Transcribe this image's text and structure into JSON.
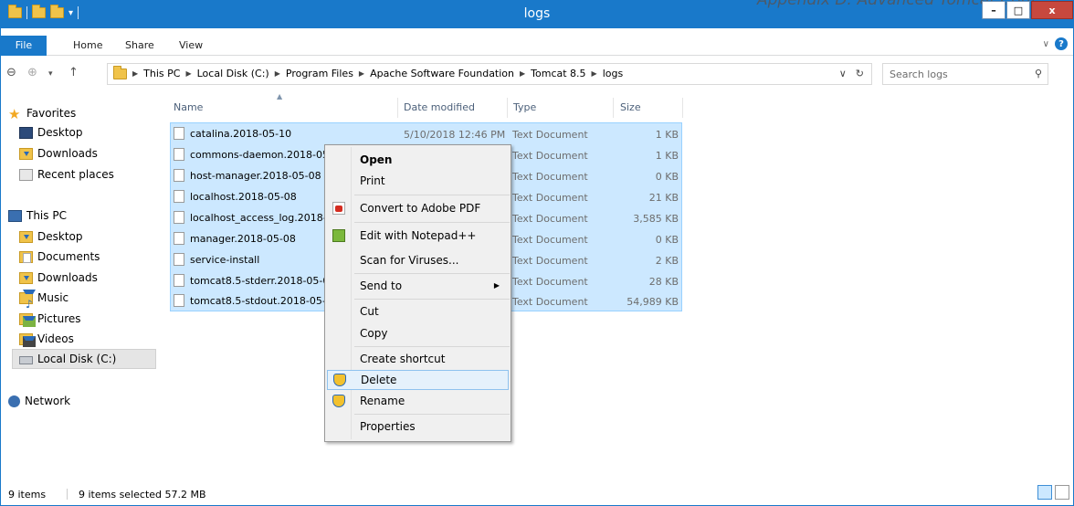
{
  "window": {
    "title": "logs"
  },
  "watermark": "Appendix D: Advanced Tomcat Conf",
  "ribbon": {
    "tabs": [
      "File",
      "Home",
      "Share",
      "View"
    ]
  },
  "address": {
    "crumbs": [
      "This PC",
      "Local Disk (C:)",
      "Program Files",
      "Apache Software Foundation",
      "Tomcat 8.5",
      "logs"
    ]
  },
  "search": {
    "placeholder": "Search logs"
  },
  "nav": {
    "favorites": "Favorites",
    "desktop": "Desktop",
    "downloads": "Downloads",
    "recent": "Recent places",
    "thispc": "This PC",
    "pc_desktop": "Desktop",
    "documents": "Documents",
    "pc_downloads": "Downloads",
    "music": "Music",
    "pictures": "Pictures",
    "videos": "Videos",
    "localdisk": "Local Disk (C:)",
    "network": "Network"
  },
  "columns": {
    "name": "Name",
    "date": "Date modified",
    "type": "Type",
    "size": "Size"
  },
  "files": [
    {
      "name": "catalina.2018-05-10",
      "date": "5/10/2018 12:46 PM",
      "type": "Text Document",
      "size": "1 KB"
    },
    {
      "name": "commons-daemon.2018-05-",
      "type": "Text Document",
      "size": "1 KB"
    },
    {
      "name": "host-manager.2018-05-08",
      "type": "Text Document",
      "size": "0 KB"
    },
    {
      "name": "localhost.2018-05-08",
      "type": "Text Document",
      "size": "21 KB"
    },
    {
      "name": "localhost_access_log.2018-05",
      "type": "Text Document",
      "size": "3,585 KB"
    },
    {
      "name": "manager.2018-05-08",
      "type": "Text Document",
      "size": "0 KB"
    },
    {
      "name": "service-install",
      "type": "Text Document",
      "size": "2 KB"
    },
    {
      "name": "tomcat8.5-stderr.2018-05-08",
      "type": "Text Document",
      "size": "28 KB"
    },
    {
      "name": "tomcat8.5-stdout.2018-05-08",
      "type": "Text Document",
      "size": "54,989 KB"
    }
  ],
  "context_menu": {
    "open": "Open",
    "print": "Print",
    "convert_pdf": "Convert to Adobe PDF",
    "edit_npp": "Edit with Notepad++",
    "scan": "Scan for Viruses...",
    "send_to": "Send to",
    "cut": "Cut",
    "copy": "Copy",
    "create_shortcut": "Create shortcut",
    "delete": "Delete",
    "rename": "Rename",
    "properties": "Properties"
  },
  "status": {
    "count": "9 items",
    "selected": "9 items selected  57.2 MB"
  },
  "colors": {
    "accent": "#1979ca",
    "close": "#c7483e",
    "selection": "#cce8ff",
    "hover": "#e5f1fb"
  }
}
